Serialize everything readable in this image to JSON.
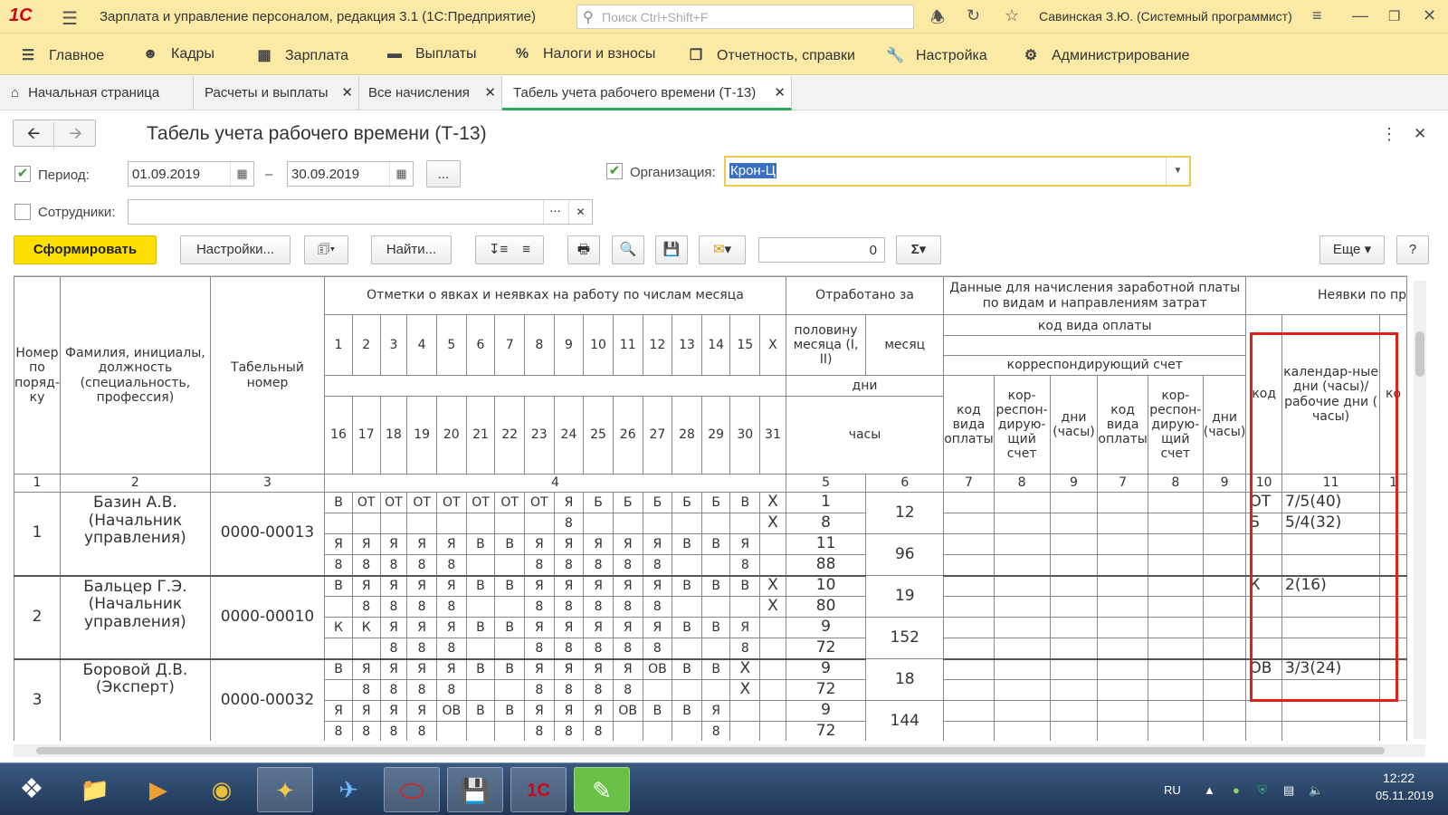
{
  "app": {
    "logo": "1С",
    "title": "Зарплата и управление персоналом, редакция 3.1 (1С:Предприятие)",
    "search_placeholder": "Поиск Ctrl+Shift+F",
    "user": "Савинская З.Ю. (Системный программист)"
  },
  "sections": [
    {
      "label": "Главное",
      "icon": "menu-icon"
    },
    {
      "label": "Кадры",
      "icon": "people-icon"
    },
    {
      "label": "Зарплата",
      "icon": "calculator-icon"
    },
    {
      "label": "Выплаты",
      "icon": "wallet-icon"
    },
    {
      "label": "Налоги и взносы",
      "icon": "percent-icon"
    },
    {
      "label": "Отчетность, справки",
      "icon": "documents-icon"
    },
    {
      "label": "Настройка",
      "icon": "wrench-icon"
    },
    {
      "label": "Администрирование",
      "icon": "gear-icon"
    }
  ],
  "tabs": [
    {
      "label": "Начальная страница",
      "icon": "home-icon"
    },
    {
      "label": "Расчеты и выплаты",
      "close": "✕"
    },
    {
      "label": "Все начисления",
      "close": "✕"
    },
    {
      "label": "Табель учета рабочего времени (Т-13)",
      "close": "✕"
    }
  ],
  "form": {
    "title": "Табель учета рабочего времени (Т-13)",
    "period_label": "Период:",
    "date_from": "01.09.2019",
    "date_sep": "–",
    "date_to": "30.09.2019",
    "choose_label": "...",
    "org_label": "Организация:",
    "org_value": "Крон-Ц",
    "employees_label": "Сотрудники:",
    "employees_value": "",
    "generate_label": "Сформировать",
    "settings_label": "Настройки...",
    "find_label": "Найти...",
    "sum_value": "0",
    "more_label": "Еще",
    "help_label": "?"
  },
  "report": {
    "headers": {
      "row_no": "Номер по поряд-ку",
      "name": "Фамилия, инициалы, должность (специальность, профессия)",
      "tab_no": "Табельный номер",
      "marks": "Отметки о явках и неявках на работу по числам месяца",
      "worked": "Отработано за",
      "half_month": "половину месяца (I, II)",
      "month": "месяц",
      "days": "дни",
      "hours": "часы",
      "pay_data": "Данные для начисления заработной платы по видам и направлениям затрат",
      "pay_code": "код вида оплаты",
      "corr_account": "корреспондирующий счет",
      "code_kind": "код вида оплаты",
      "corr_short": "кор-респон-дирую-щий счет",
      "days_hours": "дни (часы)",
      "absences": "Неявки по пр",
      "code": "код",
      "cal_days": "календар-ные дни (часы)/ рабочие дни ( часы)",
      "ko": "ко"
    },
    "days_row1": [
      "1",
      "2",
      "3",
      "4",
      "5",
      "6",
      "7",
      "8",
      "9",
      "10",
      "11",
      "12",
      "13",
      "14",
      "15",
      "X"
    ],
    "days_row2": [
      "16",
      "17",
      "18",
      "19",
      "20",
      "21",
      "22",
      "23",
      "24",
      "25",
      "26",
      "27",
      "28",
      "29",
      "30",
      "31"
    ],
    "colnums": [
      "1",
      "2",
      "3",
      "4",
      "5",
      "6",
      "7",
      "8",
      "9",
      "7",
      "8",
      "9",
      "10",
      "11",
      "1"
    ],
    "employees": [
      {
        "no": "1",
        "name": "Базин А.В. (Начальник управления)",
        "tab": "0000-00013",
        "r1": [
          "В",
          "ОТ",
          "ОТ",
          "ОТ",
          "ОТ",
          "ОТ",
          "ОТ",
          "ОТ",
          "Я",
          "Б",
          "Б",
          "Б",
          "Б",
          "Б",
          "В",
          "X"
        ],
        "r2": [
          "",
          "",
          "",
          "",
          "",
          "",
          "",
          "",
          "8",
          "",
          "",
          "",
          "",
          "",
          "",
          "X"
        ],
        "r3": [
          "Я",
          "Я",
          "Я",
          "Я",
          "Я",
          "В",
          "В",
          "Я",
          "Я",
          "Я",
          "Я",
          "Я",
          "В",
          "В",
          "Я",
          ""
        ],
        "r4": [
          "8",
          "8",
          "8",
          "8",
          "8",
          "",
          "",
          "8",
          "8",
          "8",
          "8",
          "8",
          "",
          "",
          "8",
          ""
        ],
        "half1_days": "1",
        "half1_hours": "8",
        "month_days": "12",
        "half2_days": "11",
        "half2_hours": "88",
        "month_hours": "96",
        "abs": [
          {
            "code": "ОТ",
            "val": "7/5(40)"
          },
          {
            "code": "Б",
            "val": "5/4(32)"
          },
          {
            "code": "",
            "val": ""
          },
          {
            "code": "",
            "val": ""
          }
        ]
      },
      {
        "no": "2",
        "name": "Бальцер Г.Э. (Начальник управления)",
        "tab": "0000-00010",
        "r1": [
          "В",
          "Я",
          "Я",
          "Я",
          "Я",
          "В",
          "В",
          "Я",
          "Я",
          "Я",
          "Я",
          "Я",
          "В",
          "В",
          "В",
          "X"
        ],
        "r2": [
          "",
          "8",
          "8",
          "8",
          "8",
          "",
          "",
          "8",
          "8",
          "8",
          "8",
          "8",
          "",
          "",
          "",
          "X"
        ],
        "r3": [
          "К",
          "К",
          "Я",
          "Я",
          "Я",
          "В",
          "В",
          "Я",
          "Я",
          "Я",
          "Я",
          "Я",
          "В",
          "В",
          "Я",
          ""
        ],
        "r4": [
          "",
          "",
          "8",
          "8",
          "8",
          "",
          "",
          "8",
          "8",
          "8",
          "8",
          "8",
          "",
          "",
          "8",
          ""
        ],
        "half1_days": "10",
        "half1_hours": "80",
        "month_days": "19",
        "half2_days": "9",
        "half2_hours": "72",
        "month_hours": "152",
        "abs": [
          {
            "code": "К",
            "val": "2(16)"
          },
          {
            "code": "",
            "val": ""
          },
          {
            "code": "",
            "val": ""
          },
          {
            "code": "",
            "val": ""
          }
        ]
      },
      {
        "no": "3",
        "name": "Боровой Д.В. (Эксперт)",
        "tab": "0000-00032",
        "r1": [
          "В",
          "Я",
          "Я",
          "Я",
          "Я",
          "В",
          "В",
          "Я",
          "Я",
          "Я",
          "Я",
          "ОВ",
          "В",
          "В",
          "X"
        ],
        "r2": [
          "",
          "8",
          "8",
          "8",
          "8",
          "",
          "",
          "8",
          "8",
          "8",
          "8",
          "",
          "",
          "",
          "X"
        ],
        "r3": [
          "Я",
          "Я",
          "Я",
          "Я",
          "ОВ",
          "В",
          "В",
          "Я",
          "Я",
          "Я",
          "ОВ",
          "В",
          "В",
          "Я",
          ""
        ],
        "r4": [
          "8",
          "8",
          "8",
          "8",
          "",
          "",
          "",
          "8",
          "8",
          "8",
          "",
          "",
          "",
          "8",
          ""
        ],
        "half1_days": "9",
        "half1_hours": "72",
        "month_days": "18",
        "half2_days": "9",
        "half2_hours": "72",
        "month_hours": "144",
        "abs": [
          {
            "code": "ОВ",
            "val": "3/3(24)"
          },
          {
            "code": "",
            "val": ""
          },
          {
            "code": "",
            "val": ""
          },
          {
            "code": "",
            "val": ""
          }
        ]
      }
    ]
  },
  "tray": {
    "lang": "RU",
    "time": "12:22",
    "date": "05.11.2019"
  },
  "taskbar_apps": [
    "start-orb-icon",
    "file-explorer-icon",
    "media-player-icon",
    "chrome-icon",
    "yandex-icon",
    "thunderbird-icon",
    "opera-icon",
    "save-disk-icon",
    "1c-icon",
    "messenger-icon"
  ],
  "colors": {
    "accent_yellow": "#fde000",
    "header_bg": "#fbeaa5",
    "highlight_red": "#e0201a",
    "active_tab_green": "#2aa85a"
  }
}
